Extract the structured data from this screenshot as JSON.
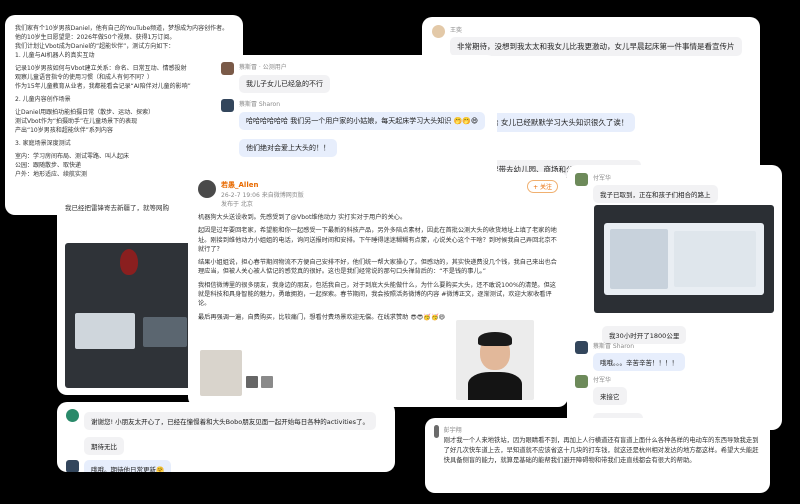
{
  "card_a": {
    "lines": [
      "我们家有个10岁男孩Daniel，他有自己的YouTube频道，梦想成为内容创作者。他的10岁生日愿望是：2026年做50个视频、获得1万订阅。",
      "我们计划让Vbot成为Daniel的“超能伙伴”，测试方向如下：",
      "1. 儿童与AI机器人的真实互动",
      "",
      "记录10岁男孩如何与Vbot建立关系：命名、日常互动、情感投射",
      "观察儿童语音指令的使用习惯（和成人有何不同？）",
      "作为15年儿童教育从业者，我都能看会记录“AI陪伴对儿童的影响”",
      "",
      "2. 儿童内容创作场景",
      "",
      "让Daniel用跟拍功能拍摄日常（散步、运动、探索）",
      "测试Vbot作为“拍摄助手”在儿童场景下的表现",
      "产出“10岁男孩和超能伙伴”系列内容",
      "",
      "3. 家庭场景深度测试",
      "",
      "室内：学习房间布局、测试零路、叫人起床",
      "公园：跟随散步、取快递",
      "户外：地形适应、续航实测"
    ]
  },
  "card_b": {
    "msg1_name": "蔡斯冒 · 公测用户",
    "msg1_text": "我儿子女儿已经急的不行",
    "msg2_name": "蔡斯冒 Sharon",
    "msg2_text": "哈哈哈哈哈哈 我们另一个用户家的小姑娘，每天起床学习大头知识 🤭🤭😄",
    "msg3_text": "他们绝对会爱上大头的！！",
    "msg4_name": "蔡斯冒 · 公测用户",
    "msg4_text": "我已经把雷锋寄去新疆了，就等网购"
  },
  "card_c": {
    "name": "王奕",
    "msg1": "非常期待，没想到我太太和我女儿比我更激动，女儿早晨起床第一件事情是看宣传片",
    "msg2": "哈 女儿已经默默学习大头知识很久了诶！",
    "msg3": "要带去幼儿园、商场和公园技大头以令诸侯"
  },
  "card_d": {
    "msg1_name": "付军华",
    "msg1_text": "我子已取到，正在和孩子们相合的路上",
    "msg2_text": "我30小时开了1800公里",
    "msg3_name": "蔡斯冒 Sharon",
    "msg3_text": "哦哦。。。辛苦辛苦！！！！",
    "msg4_name": "付军华",
    "msg4_text": "来接它",
    "msg5_text": "进到200km"
  },
  "card_e": {
    "author": "若愚_Allen",
    "meta": "26-2-7 19:06  来自微博网页版",
    "location": "发布于 北京",
    "follow": "+ 关注",
    "p1": "机器狗大头送设收到。先感受到了@Vbot维他动力 实打实对于用户的关心。",
    "p2": "起因是过年要回老家，希望能和你一起感受一下最新的科技产品，另外多陪点素材，因此在首批公测大头的收货地址上填了老家的地址。刚接到维他动力小姐姐的电话，询问送报时间和安排。下午睡得迷迷糊糊有点蒙，心说关心这个干啥？到时候我自己弄回北京不就行了？",
    "p3": "结果小姐姐说，担心春节期间物流不方便自己安排不好，他们统一帮大家操心了。但感动的，其实快递费没几个钱，我自己来出也合理应当，但被人关心被人惦记的感觉真的很好。这也是我们经常说的那句口头禅背后的：“不是钱的事儿。”",
    "p4": "我相信微博里的很多朋友，我身边的朋友，包括我自己，对于到底大头能做什么，为什么要购买大头，还不敢说100%的清楚。但这就是科技和具身智能的魅力，勇敢拥抱，一起探索。春节期间，我会按照活务微博的内容 #微博正文，逐渐测试，欢迎大家收看评论。",
    "p5": "最后再强调一遍，自费购买，比较痛门，想看付费场景欢迎无偿。在线求赞助 😎😎🥳🥳😄"
  },
  "card_f": {
    "msg1": "谢谢您! 小朋友太开心了，已经在憧憬着和大头Bobo朋友见面一起开始每日各种的activities了。",
    "msg2": "期待无比",
    "msg3": "哦哦。期待他日常更新🤗"
  },
  "card_g": {
    "name": "彭宇翔",
    "text": "刚才我一个人来地铁站，因为眼睛看不到，再加上人行横道还有盲道上面什么各种各样的电动车的东西导致我走到了好几次快车道上去，早知道就不应该省这十几块的打车钱，就这还是杭州相对发达的地方都这样。希望大头能赶快具备侧盲的能力，就算是基础的能帮我们避开障碍物和带我们走直线都会有很大的帮助。"
  }
}
